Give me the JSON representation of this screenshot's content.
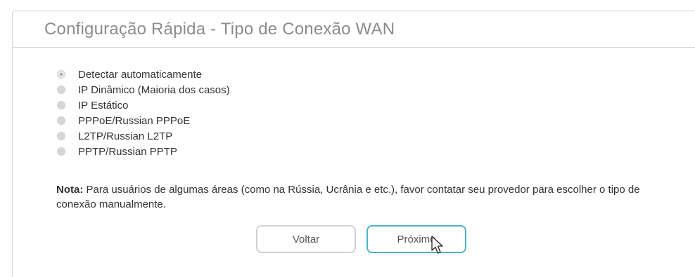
{
  "header": {
    "title": "Configuração Rápida - Tipo de Conexão WAN"
  },
  "connection_types": [
    {
      "label": "Detectar automaticamente",
      "selected": true
    },
    {
      "label": "IP Dinâmico (Maioria dos casos)",
      "selected": false
    },
    {
      "label": "IP Estático",
      "selected": false
    },
    {
      "label": "PPPoE/Russian PPPoE",
      "selected": false
    },
    {
      "label": "L2TP/Russian L2TP",
      "selected": false
    },
    {
      "label": "PPTP/Russian PPTP",
      "selected": false
    }
  ],
  "note": {
    "label": "Nota:",
    "text": " Para usuários de algumas áreas (como na Rússia, Ucrânia e etc.), favor contatar seu provedor para escolher o tipo de conexão manualmente."
  },
  "buttons": {
    "back": "Voltar",
    "next": "Próximo"
  },
  "colors": {
    "accent": "#4bb3c7",
    "title": "#8c8c8c",
    "border": "#d6d6d6"
  }
}
